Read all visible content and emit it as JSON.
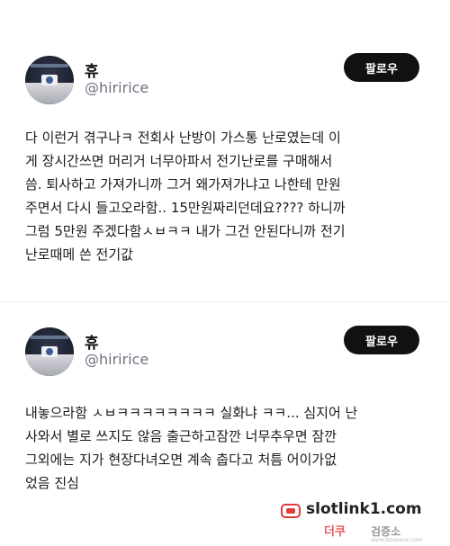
{
  "posts": [
    {
      "author": {
        "name": "휴",
        "handle": "@hiririce"
      },
      "follow_label": "팔로우",
      "text_lines": [
        "다 이런거 겪구나ㅋ 전회사 난방이 가스통 난로였는데 이",
        "게 장시간쓰면 머리거 너무아파서 전기난로를 구매해서",
        "씀. 퇴사하고 가져가니까 그거 왜가져가냐고 나한테 만원",
        "주면서 다시 들고오라함.. 15만원짜리던데요???? 하니까",
        "그럼 5만원 주겠다함ㅅㅂㅋㅋ 내가 그건 안된다니까 전기",
        "난로때메 쓴 전기값"
      ]
    },
    {
      "author": {
        "name": "휴",
        "handle": "@hiririce"
      },
      "follow_label": "팔로우",
      "text_lines": [
        "내놓으라함 ㅅㅂㅋㅋㅋㅋㅋㅋㅋㅋ 실화냐 ㅋㅋ... 심지어 난",
        "사와서 별로 쓰지도 않음 출근하고잠깐 너무추우면 잠깐",
        "그외에는 지가 현장다녀오면 계속 춥다고 처틈 어이가없",
        "었음 진심"
      ]
    }
  ],
  "watermark": {
    "url": "slotlink1.com",
    "sub": "더쿠",
    "sub2": "검증소",
    "tiny": "www.tetosave.com"
  }
}
